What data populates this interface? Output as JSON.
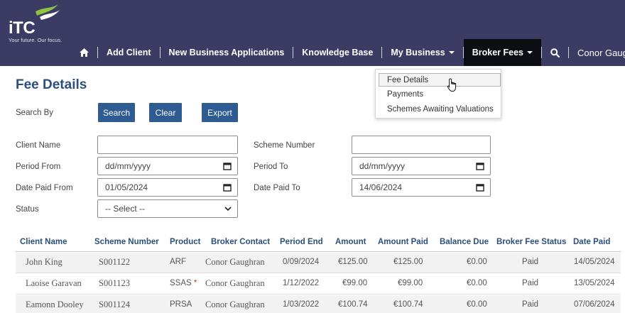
{
  "brand": {
    "logo_text": "iTC",
    "tagline": "Your future. Our focus."
  },
  "nav": {
    "add_client": "Add Client",
    "new_business": "New Business Applications",
    "knowledge_base": "Knowledge Base",
    "my_business": "My Business",
    "broker_fees": "Broker Fees",
    "user": "Conor Gaughran"
  },
  "dropdown": {
    "items": [
      "Fee Details",
      "Payments",
      "Schemes Awaiting Valuations"
    ]
  },
  "page": {
    "title": "Fee Details"
  },
  "search": {
    "search_by": "Search By",
    "search_btn": "Search",
    "clear_btn": "Clear",
    "export_btn": "Export",
    "client_name_label": "Client Name",
    "client_name_value": "",
    "scheme_number_label": "Scheme Number",
    "scheme_number_value": "",
    "period_from_label": "Period From",
    "period_from_value": "dd/mm/yyyy",
    "period_to_label": "Period To",
    "period_to_value": "dd/mm/yyyy",
    "date_paid_from_label": "Date Paid From",
    "date_paid_from_value": "01/05/2024",
    "date_paid_to_label": "Date Paid To",
    "date_paid_to_value": "14/06/2024",
    "status_label": "Status",
    "status_value": "-- Select --"
  },
  "table": {
    "headers": [
      "Client Name",
      "Scheme Number",
      "Product",
      "Broker Contact",
      "Period End",
      "Amount",
      "Amount Paid",
      "Balance Due",
      "Broker Fee Status",
      "Date Paid"
    ],
    "rows": [
      {
        "client": "John King",
        "scheme": "S001122",
        "product": "ARF",
        "required": "",
        "contact": "Conor Gaughran",
        "period_end": "0/09/2024",
        "amount": "€125.00",
        "paid": "€125.00",
        "balance": "€0.00",
        "status": "Paid",
        "date_paid": "14/05/2024"
      },
      {
        "client": "Laoise Garavan",
        "scheme": "S001123",
        "product": "SSAS",
        "required": "*",
        "contact": "Conor Gaughran",
        "period_end": "1/12/2022",
        "amount": "€99.00",
        "paid": "€99.00",
        "balance": "€0.00",
        "status": "Paid",
        "date_paid": "13/05/2024"
      },
      {
        "client": "Eamonn Dooley",
        "scheme": "S001124",
        "product": "PRSA",
        "required": "",
        "contact": "Conor Gaughran",
        "period_end": "1/03/2022",
        "amount": "€100.74",
        "paid": "€100.74",
        "balance": "€0.00",
        "status": "Paid",
        "date_paid": "07/06/2024"
      }
    ]
  },
  "colors": {
    "header_bg": "#3b3b63",
    "accent": "#2f5b93",
    "title": "#2b4f7e"
  }
}
